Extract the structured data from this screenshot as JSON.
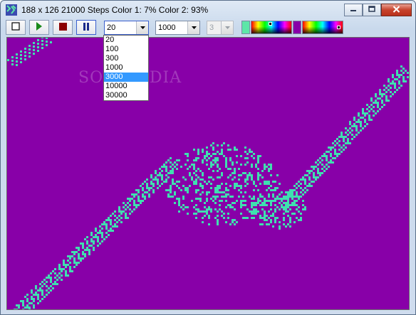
{
  "window": {
    "title": "188 x 126  21000 Steps  Color 1: 7%  Color 2: 93%"
  },
  "toolbar": {
    "buttons": [
      {
        "name": "stop-square-button",
        "icon": "square-outline-icon"
      },
      {
        "name": "play-button",
        "icon": "play-icon",
        "color": "#1a8a1a"
      },
      {
        "name": "stop-button",
        "icon": "stop-icon",
        "color": "#8b0000"
      },
      {
        "name": "pause-button",
        "icon": "pause-icon",
        "color": "#1a2a8a"
      }
    ],
    "speed_combo": {
      "value": "20",
      "options": [
        "20",
        "100",
        "300",
        "1000",
        "3000",
        "10000",
        "30000"
      ],
      "highlighted": "3000"
    },
    "steps_combo": {
      "value": "1000"
    },
    "colors_combo": {
      "value": "3",
      "disabled": true
    },
    "color1": "#5de6a8",
    "color2": "#8800a8"
  },
  "canvas": {
    "background": "#8800a8",
    "cell_color": "#3fe0b0",
    "watermark": "SOFTPEDIA"
  }
}
